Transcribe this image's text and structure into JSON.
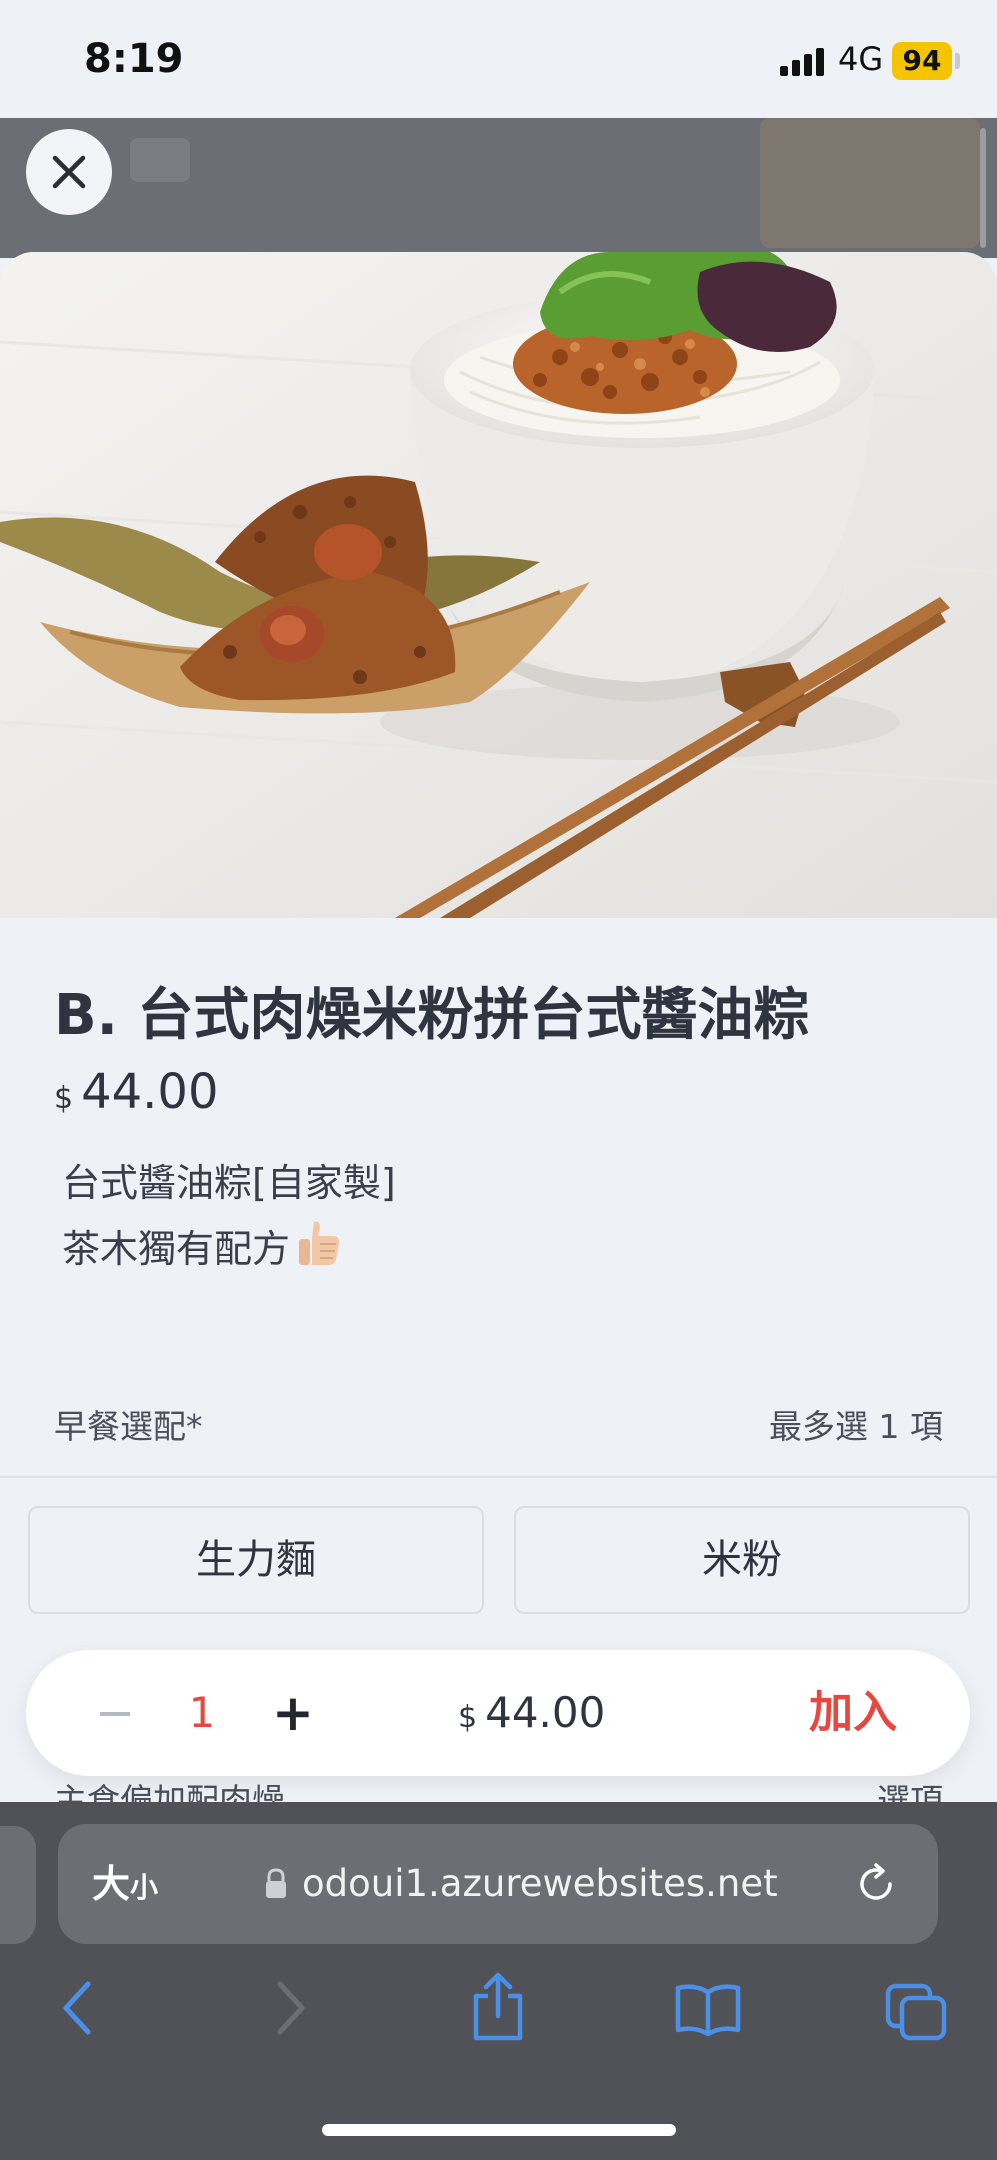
{
  "status_bar": {
    "time": "8:19",
    "network": "4G",
    "battery": "94"
  },
  "item": {
    "title": "B. 台式肉燥米粉拼台式醬油粽",
    "currency": "$",
    "price": "44.00",
    "description_lines": [
      "台式醬油粽[自家製]",
      "茶木獨有配方"
    ],
    "image_alt": "台式肉燥米粉拼台式醬油粽"
  },
  "options": {
    "label": "早餐選配*",
    "limit_text": "最多選 1 項",
    "choices": [
      "生力麵",
      "米粉"
    ]
  },
  "next_section": {
    "label": "主食偏加配肉燥",
    "note": "選項"
  },
  "order_bar": {
    "minus": "−",
    "quantity": "1",
    "plus": "+",
    "currency": "$",
    "total": "44.00",
    "add_label": "加入"
  },
  "browser": {
    "text_size_big": "大",
    "text_size_small": "小",
    "url": "odoui1.azurewebsites.net"
  },
  "icons": {
    "close": "close-icon",
    "lock": "lock-icon",
    "reload": "reload-icon",
    "back": "back-icon",
    "forward": "forward-icon",
    "share": "share-icon",
    "bookmarks": "book-icon",
    "tabs": "tabs-icon",
    "thumbs_up": "thumbs-up-icon"
  },
  "colors": {
    "accent_red": "#e5483f",
    "link_blue": "#4a90e8",
    "battery_yellow": "#f5c400"
  }
}
